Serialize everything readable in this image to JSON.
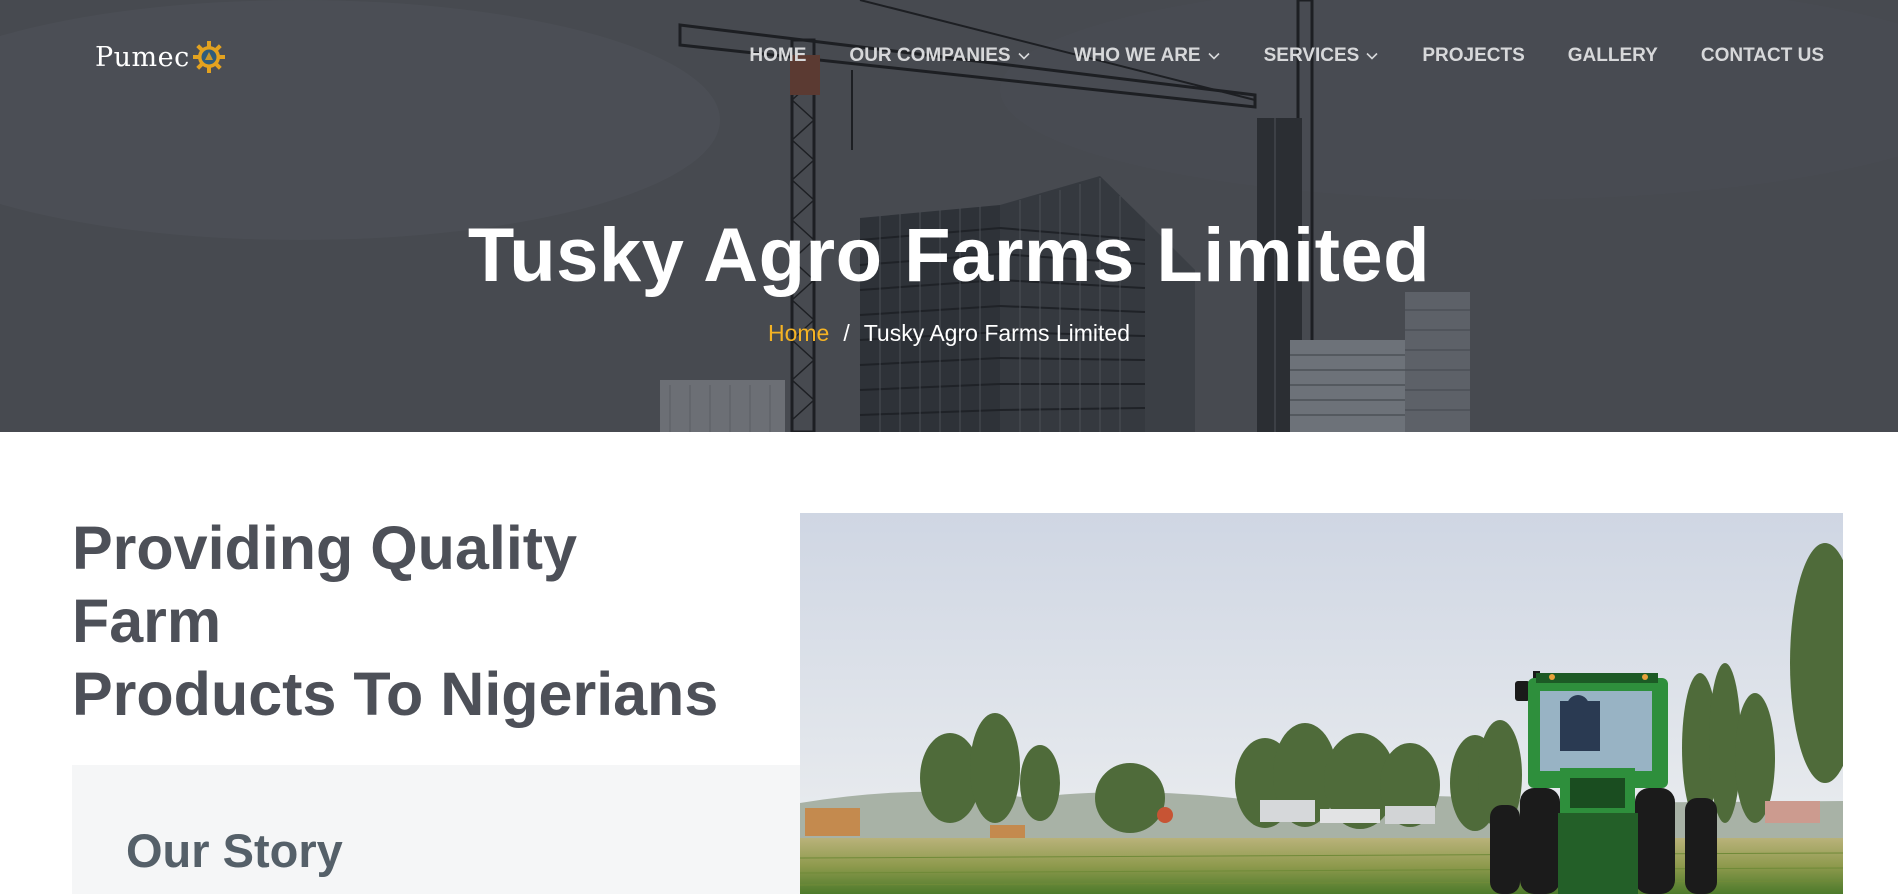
{
  "logo": {
    "text": "Pumec",
    "icon": "gear-logo-icon"
  },
  "nav": {
    "items": [
      {
        "label": "HOME",
        "dropdown": false
      },
      {
        "label": "OUR COMPANIES",
        "dropdown": true
      },
      {
        "label": "WHO WE ARE",
        "dropdown": true
      },
      {
        "label": "SERVICES",
        "dropdown": true
      },
      {
        "label": "PROJECTS",
        "dropdown": false
      },
      {
        "label": "GALLERY",
        "dropdown": false
      },
      {
        "label": "CONTACT US",
        "dropdown": false
      }
    ]
  },
  "hero": {
    "title": "Tusky Agro Farms Limited",
    "breadcrumb": {
      "home": "Home",
      "separator": "/",
      "current": "Tusky Agro Farms Limited"
    }
  },
  "intro": {
    "heading_line1": "Providing Quality Farm",
    "heading_line2": "Products To Nigerians"
  },
  "story": {
    "title": "Our Story"
  },
  "colors": {
    "accent": "#f5b324",
    "heading": "#4d5058",
    "story_heading": "#556069",
    "card_bg": "#f5f6f7"
  }
}
